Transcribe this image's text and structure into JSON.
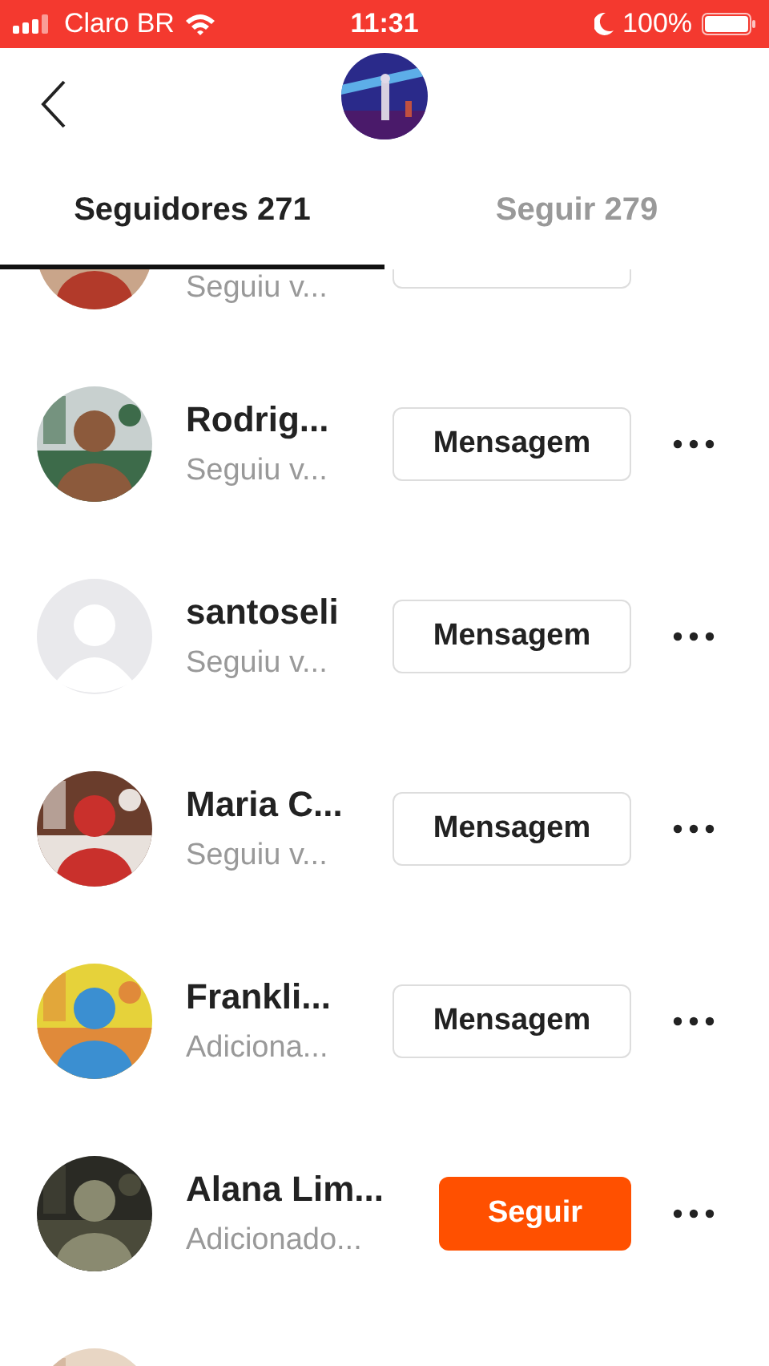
{
  "status_bar": {
    "carrier": "Claro BR",
    "time": "11:31",
    "battery": "100%"
  },
  "tabs": [
    {
      "label": "Seguidores 271",
      "selected": true
    },
    {
      "label": "Seguir 279",
      "selected": false
    }
  ],
  "followers": [
    {
      "kind": "picture",
      "subtitle": "Seguiu v...",
      "button": {
        "kind": "message"
      }
    },
    {
      "kind": "picture",
      "name": "Rodrig...",
      "subtitle": "Seguiu v...",
      "button": {
        "kind": "message",
        "label": "Mensagem"
      }
    },
    {
      "kind": "placeholder",
      "name": "santoseli",
      "subtitle": "Seguiu v...",
      "button": {
        "kind": "message",
        "label": "Mensagem"
      }
    },
    {
      "kind": "picture",
      "name": "Maria C...",
      "subtitle": "Seguiu v...",
      "button": {
        "kind": "message",
        "label": "Mensagem"
      }
    },
    {
      "kind": "picture",
      "name": "Frankli...",
      "subtitle": "Adiciona...",
      "button": {
        "kind": "message",
        "label": "Mensagem"
      }
    },
    {
      "kind": "picture",
      "name": "Alana Lim...",
      "subtitle": "Adicionado...",
      "button": {
        "kind": "follow",
        "label": "Seguir"
      }
    },
    {
      "kind": "picture"
    }
  ]
}
